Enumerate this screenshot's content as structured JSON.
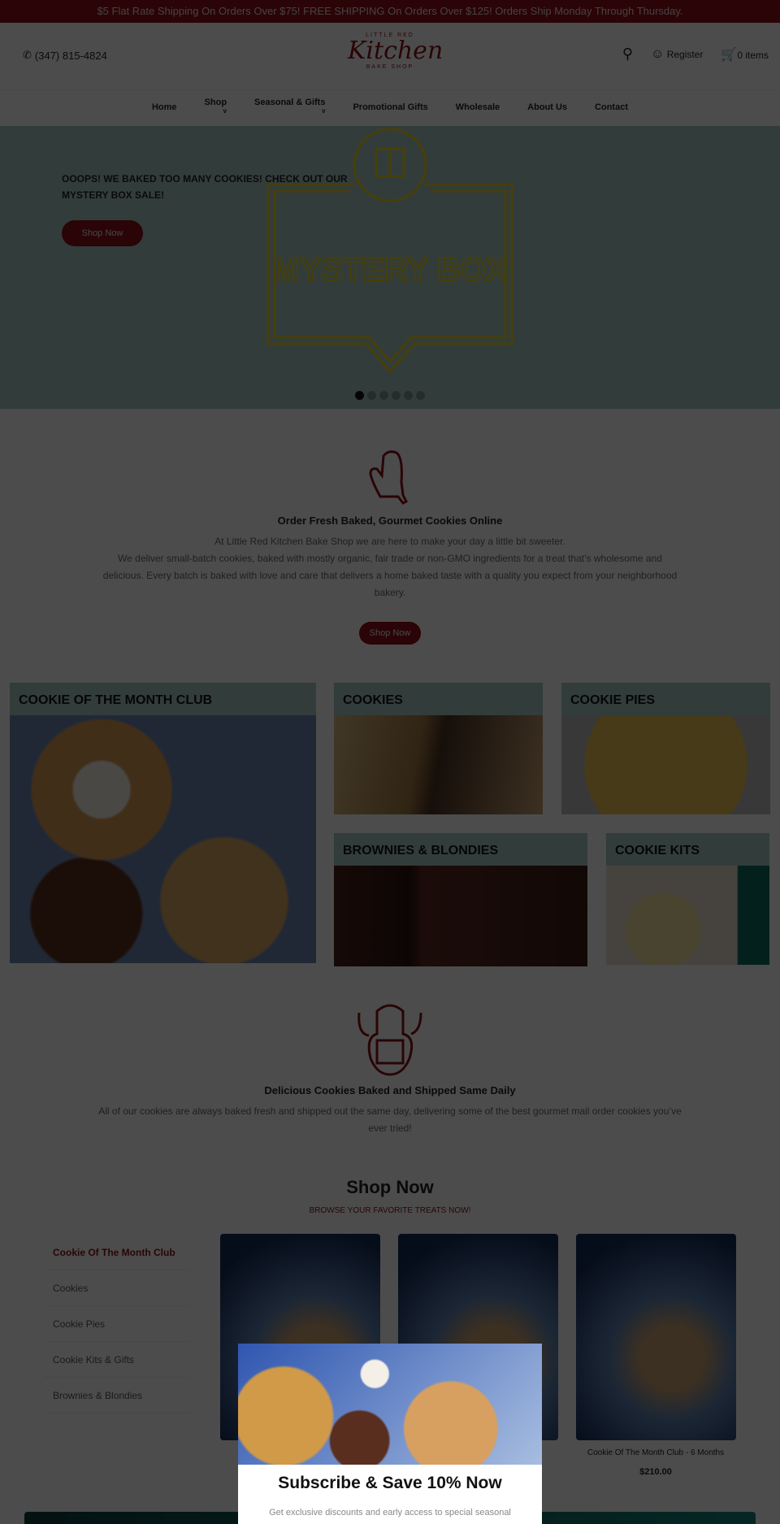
{
  "topbar": {
    "text": "$5 Flat Rate Shipping On Orders Over $75! FREE SHIPPING On Orders Over $125! Orders Ship Monday Through Thursday."
  },
  "header": {
    "phone": "(347) 815-4824",
    "logo": {
      "top": "LITTLE RED",
      "main": "Kitchen",
      "bottom": "BAKE SHOP"
    },
    "register": "Register",
    "cart": "0 items"
  },
  "nav": [
    {
      "label": "Home"
    },
    {
      "label": "Shop",
      "dropdown": true
    },
    {
      "label": "Seasonal & Gifts",
      "dropdown": true
    },
    {
      "label": "Promotional Gifts"
    },
    {
      "label": "Wholesale"
    },
    {
      "label": "About Us"
    },
    {
      "label": "Contact"
    }
  ],
  "hero": {
    "headline": "OOOPS! WE BAKED TOO MANY COOKIES! CHECK OUT OUR MYSTERY BOX SALE!",
    "button": "Shop Now",
    "image_text": "MYSTERY BOX",
    "slides": 6,
    "active_slide": 1
  },
  "intro": {
    "title": "Order Fresh Baked, Gourmet Cookies Online",
    "line1": "At Little Red Kitchen Bake Shop we are here to make your day a little bit sweeter.",
    "line2": "We deliver small-batch cookies, baked with mostly organic, fair trade or non-GMO ingredients for a treat that’s wholesome and delicious. Every batch is baked with love and care that delivers a home baked taste with a quality you expect from your neighborhood bakery.",
    "button": "Shop Now"
  },
  "categories": [
    {
      "label": "COOKIE OF THE MONTH CLUB"
    },
    {
      "label": "COOKIES"
    },
    {
      "label": "COOKIE PIES"
    },
    {
      "label": "BROWNIES & BLONDIES"
    },
    {
      "label": "COOKIE KITS"
    }
  ],
  "daily": {
    "title": "Delicious Cookies Baked and Shipped Same Daily",
    "text": "All of our cookies are always baked fresh and shipped out the same day, delivering some of the best gourmet mail order cookies you’ve ever tried!"
  },
  "shop": {
    "title": "Shop Now",
    "subtitle": "BROWSE YOUR FAVORITE TREATS NOW!",
    "sidebar": [
      "Cookie Of The Month Club",
      "Cookies",
      "Cookie Pies",
      "Cookie Kits & Gifts",
      "Brownies & Blondies"
    ],
    "products": [
      {
        "title": "Cookie Of The Month Club - 6 Months",
        "price": "$210.00"
      }
    ]
  },
  "popup": {
    "title": "Subscribe & Save 10% Now",
    "text": "Get exclusive discounts and early access to special seasonal"
  },
  "colors": {
    "brand": "#8b0d14",
    "hero_bg": "#a8c8c6"
  }
}
